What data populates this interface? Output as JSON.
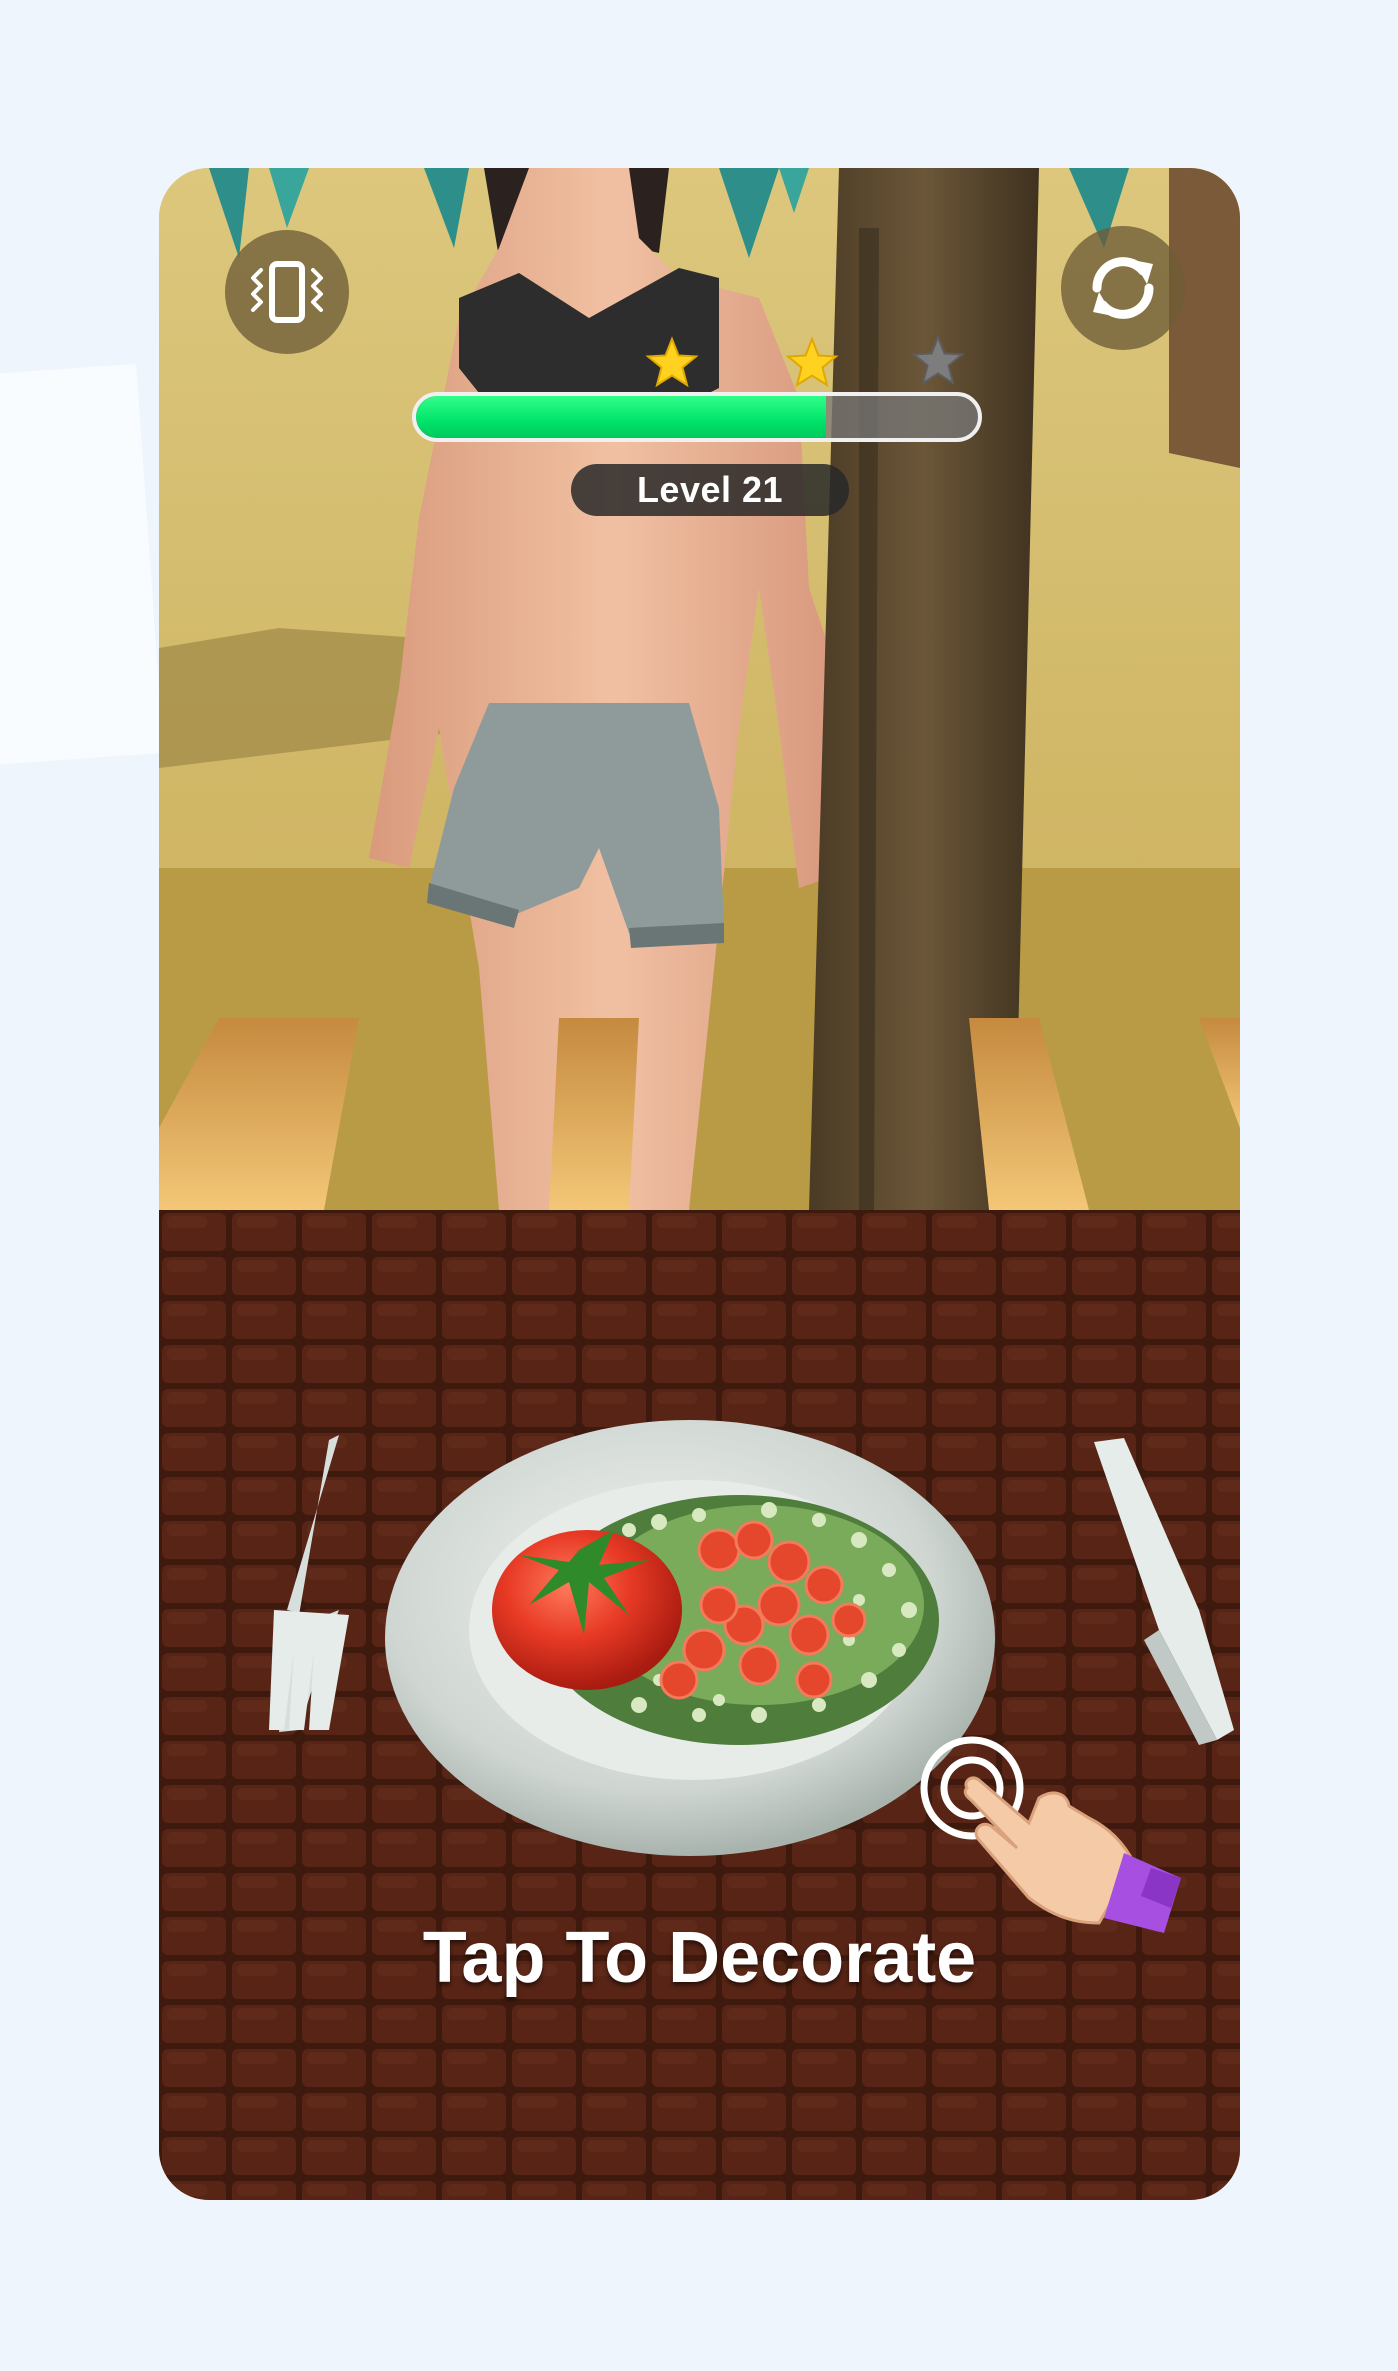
{
  "hud": {
    "vibrate_icon": "vibrate-phone-icon",
    "restart_icon": "restart-arrows-icon",
    "level_label": "Level 21",
    "progress_value": 0.73,
    "stars_earned": 2,
    "stars_total": 3
  },
  "prompt": {
    "tap_label": "Tap To Decorate",
    "hand_icon": "tap-hand-icon"
  },
  "colors": {
    "progress_fill": "#00e36a",
    "star_active": "#ffd21f",
    "star_inactive": "#7d7d7d",
    "wristband": "#a64fe0",
    "page_background": "#eef5fc"
  }
}
